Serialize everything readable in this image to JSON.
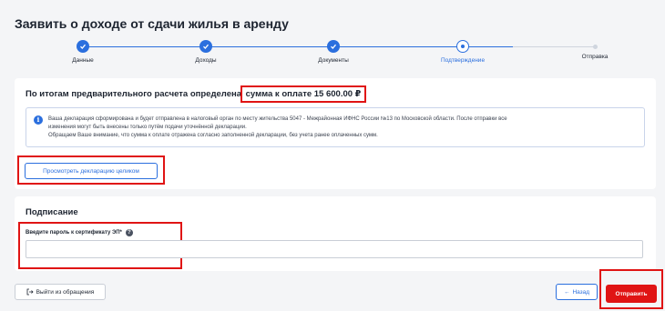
{
  "page": {
    "title": "Заявить о доходе от сдачи жилья в аренду"
  },
  "stepper": {
    "steps": [
      {
        "label": "Данные",
        "state": "done"
      },
      {
        "label": "Доходы",
        "state": "done"
      },
      {
        "label": "Документы",
        "state": "done"
      },
      {
        "label": "Подтверждение",
        "state": "current"
      },
      {
        "label": "Отправка",
        "state": "pending"
      }
    ]
  },
  "result": {
    "title_prefix": "По итогам предварительного расчета определена ",
    "title_amount": "сумма к оплате 15 600.00 ₽"
  },
  "info": {
    "line1": "Ваша декларация сформирована и будет отправлена в налоговый орган по месту жительства 5047 - Межрайонная ИФНС России №13 по Московской области. После отправки все",
    "line2": "изменения могут быть внесены только путём подачи уточнённой декларации.",
    "line3": "Обращаем Ваше внимание, что сумма к оплате отражена согласно заполненной декларации, без учета ранее оплаченных сумм."
  },
  "view_button": {
    "label": "Просмотреть декларацию целиком"
  },
  "signing": {
    "title": "Подписание",
    "password_label": "Введите пароль к сертификату ЭП*",
    "password_value": ""
  },
  "footer": {
    "exit_label": "Выйти из обращения",
    "back_label": "Назад",
    "send_label": "Отправить"
  },
  "colors": {
    "accent": "#2b6fde",
    "highlight": "#e01414"
  }
}
